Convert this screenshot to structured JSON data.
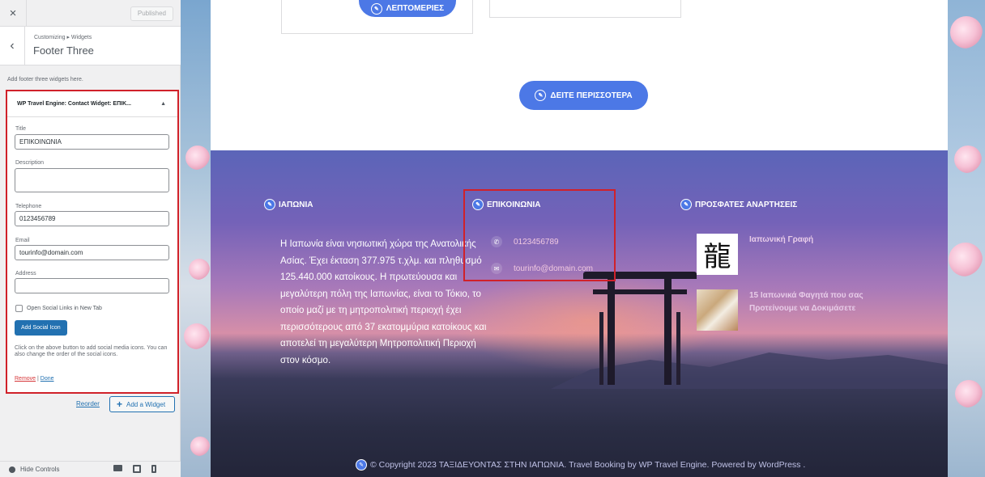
{
  "customizer": {
    "published_label": "Published",
    "breadcrumb": "Customizing ▸ Widgets",
    "section_title": "Footer Three",
    "intro": "Add footer three widgets here.",
    "widget": {
      "title": "WP Travel Engine: Contact Widget: ΕΠΙΚ...",
      "fields": {
        "title_label": "Title",
        "title_value": "ΕΠΙΚΟΙΝΩΝΙΑ",
        "description_label": "Description",
        "telephone_label": "Telephone",
        "telephone_value": "0123456789",
        "email_label": "Email",
        "email_value": "tourinfo@domain.com",
        "address_label": "Address",
        "address_value": ""
      },
      "open_social_label": "Open Social Links in New Tab",
      "add_social_label": "Add Social Icon",
      "help_text": "Click on the above button to add social media icons. You can also change the order of the social icons.",
      "remove_label": "Remove",
      "separator": " | ",
      "done_label": "Done"
    },
    "reorder_label": "Reorder",
    "add_widget_label": "Add a Widget",
    "hide_controls_label": "Hide Controls"
  },
  "preview": {
    "details_button": "ΛΕΠΤΟΜΕΡΙΕΣ",
    "see_more_button": "ΔΕΙΤΕ ΠΕΡΙΣΣΟΤΕΡΑ",
    "footer": {
      "col1_title": "ΙΑΠΩΝΙΑ",
      "col1_text": "Η Ιαπωνία είναι νησιωτική χώρα της Ανατολικής Ασίας. Έχει έκταση 377.975 τ.χλμ. και πληθυσμό 125.440.000 κατοίκους. Η πρωτεύουσα και μεγαλύτερη πόλη της Ιαπωνίας, είναι το Τόκιο, το οποίο μαζί με τη μητροπολιτική περιοχή έχει περισσότερους από 37 εκατομμύρια κατοίκους και αποτελεί τη μεγαλύτερη Μητροπολιτική Περιοχή στον κόσμο.",
      "col2_title": "ΕΠΙΚΟΙΝΩΝΙΑ",
      "phone": "0123456789",
      "email": "tourinfo@domain.com",
      "col3_title": "ΠΡΟΣΦΑΤΕΣ ΑΝΑΡΤΗΣΕΙΣ",
      "posts": [
        {
          "title": "Ιαπωνική Γραφή",
          "thumb_glyph": "龍"
        },
        {
          "title": "15 Ιαπωνικά Φαγητά που σας Προτείνουμε να Δοκιμάσετε"
        }
      ],
      "copyright": "© Copyright 2023 ΤΑΞΙΔΕΥΟΝΤΑΣ ΣΤΗΝ ΙΑΠΩΝΙΑ. Travel Booking by WP Travel Engine. Powered by WordPress ."
    }
  },
  "icons": {
    "close": "×",
    "back": "‹",
    "collapse": "▲",
    "plus": "+",
    "pencil": "✎",
    "phone": "✆",
    "mail": "✉"
  }
}
